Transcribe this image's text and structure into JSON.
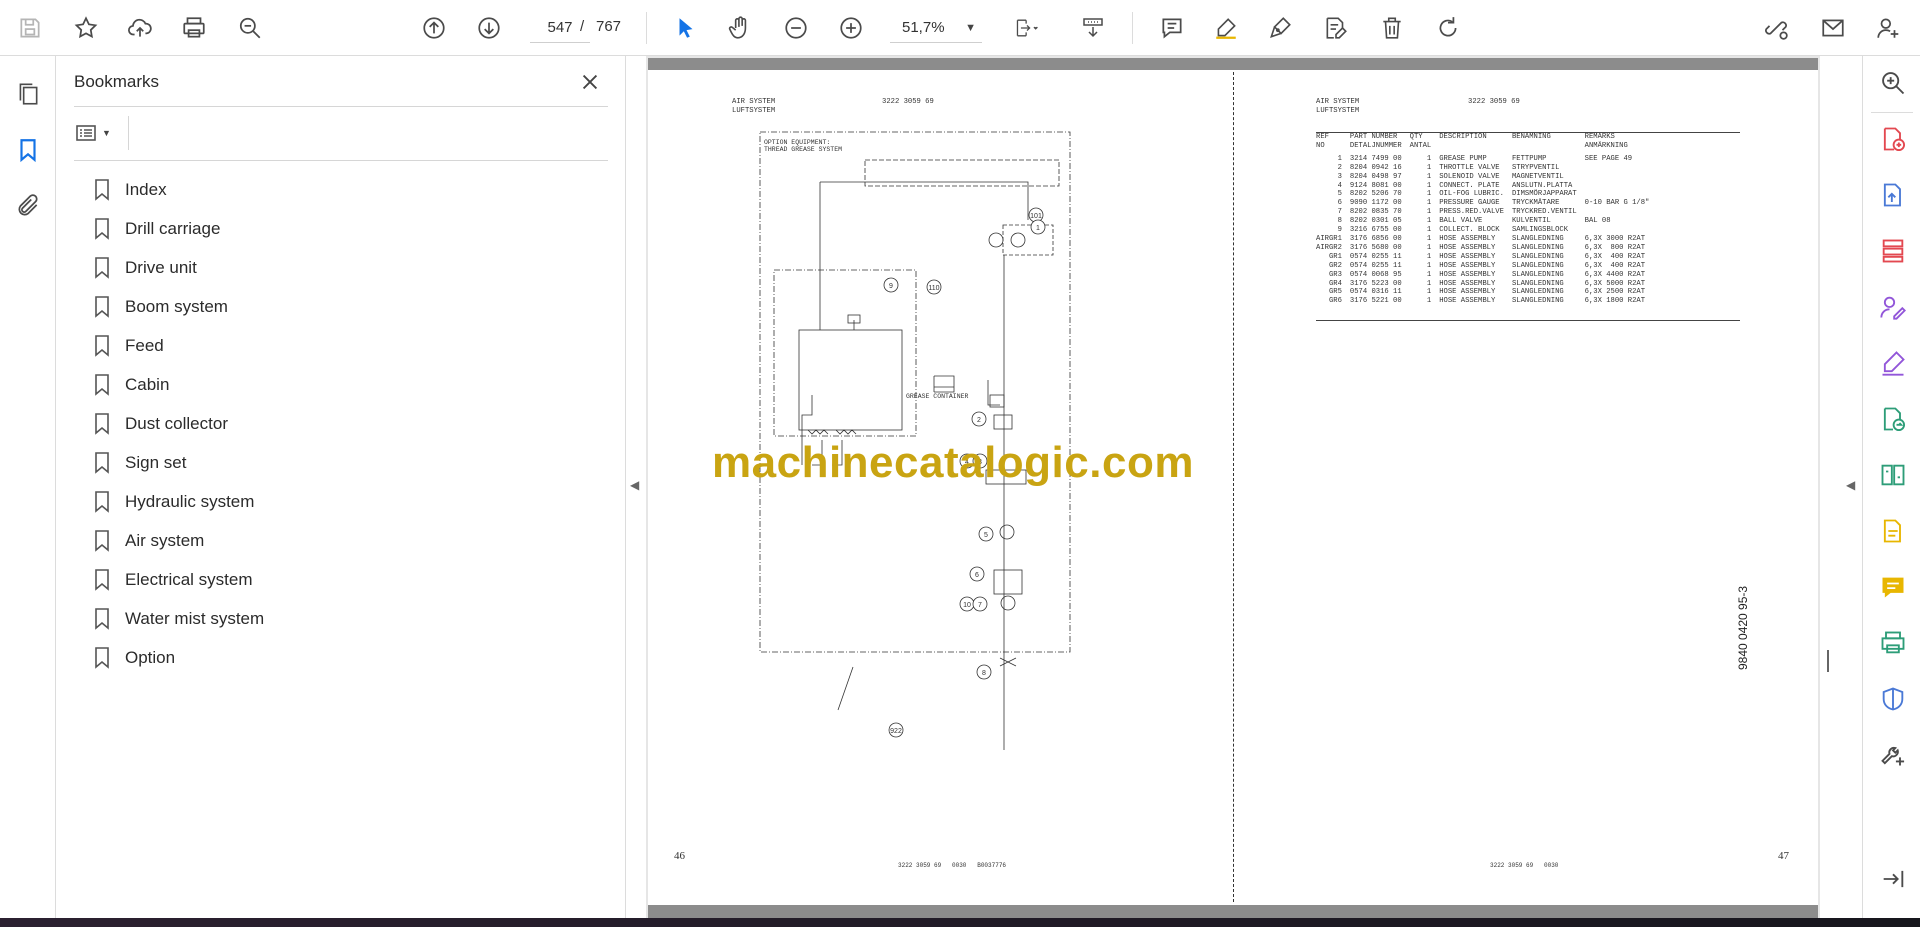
{
  "toolbar": {
    "page_current": "547",
    "page_separator": "/",
    "page_total": "767",
    "zoom": "51,7%"
  },
  "panel": {
    "title": "Bookmarks",
    "bookmarks": [
      "Index",
      "Drill carriage",
      "Drive unit",
      "Boom system",
      "Feed",
      "Cabin",
      "Dust collector",
      "Sign set",
      "Hydraulic system",
      "Air system",
      "Electrical system",
      "Water mist system",
      "Option"
    ]
  },
  "doc": {
    "left_header_1": "AIR SYSTEM",
    "left_header_2": "LUFTSYSTEM",
    "left_header_code": "3222 3059 69",
    "right_header_1": "AIR SYSTEM",
    "right_header_2": "LUFTSYSTEM",
    "right_header_code": "3222 3059 69",
    "left_page_number": "46",
    "right_page_number": "47",
    "left_footer": "3222 3059 69   0030   B0037776",
    "right_footer": "3222 3059 69   0030",
    "drawing_number": "9840 0420 95-3",
    "option_label_1": "OPTION EQUIPMENT:",
    "option_label_2": "THREAD GREASE SYSTEM",
    "grease_container": "GREASE CONTAINER",
    "watermark": "machinecatalogic.com",
    "table_headers": [
      [
        "REF",
        "NO"
      ],
      [
        "PART NUMBER",
        "DETALJNUMMER"
      ],
      [
        "QTY",
        "ANTAL"
      ],
      [
        "DESCRIPTION",
        ""
      ],
      [
        "BENÄMNING",
        ""
      ],
      [
        "REMARKS",
        "ANMÄRKNING"
      ]
    ],
    "parts": [
      [
        "1",
        "3214 7499 00",
        "1",
        "GREASE PUMP",
        "FETTPUMP",
        "SEE PAGE 49"
      ],
      [
        "2",
        "8204 0942 16",
        "1",
        "THROTTLE VALVE",
        "STRYPVENTIL",
        ""
      ],
      [
        "3",
        "8204 0498 97",
        "1",
        "SOLENOID VALVE",
        "MAGNETVENTIL",
        ""
      ],
      [
        "4",
        "9124 8081 00",
        "1",
        "CONNECT. PLATE",
        "ANSLUTN.PLATTA",
        ""
      ],
      [
        "5",
        "8202 5206 70",
        "1",
        "OIL-FOG LUBRIC.",
        "DIMSMÖRJAPPARAT",
        ""
      ],
      [
        "6",
        "9090 1172 00",
        "1",
        "PRESSURE GAUGE",
        "TRYCKMÄTARE",
        "0-10 BAR G 1/8\""
      ],
      [
        "7",
        "8202 0835 70",
        "1",
        "PRESS.RED.VALVE",
        "TRYCKRED.VENTIL",
        ""
      ],
      [
        "8",
        "8202 0301 05",
        "1",
        "BALL VALVE",
        "KULVENTIL",
        "BAL 08"
      ],
      [
        "9",
        "3216 6755 00",
        "1",
        "COLLECT. BLOCK",
        "SAMLINGSBLOCK",
        ""
      ],
      [
        "AIRGR1",
        "3176 6856 00",
        "1",
        "HOSE ASSEMBLY",
        "SLANGLEDNING",
        "6,3X 3000 R2AT"
      ],
      [
        "AIRGR2",
        "3176 5680 00",
        "1",
        "HOSE ASSEMBLY",
        "SLANGLEDNING",
        "6,3X  800 R2AT"
      ],
      [
        "GR1",
        "0574 0255 11",
        "1",
        "HOSE ASSEMBLY",
        "SLANGLEDNING",
        "6,3X  400 R2AT"
      ],
      [
        "GR2",
        "0574 0255 11",
        "1",
        "HOSE ASSEMBLY",
        "SLANGLEDNING",
        "6,3X  400 R2AT"
      ],
      [
        "GR3",
        "0574 0068 95",
        "1",
        "HOSE ASSEMBLY",
        "SLANGLEDNING",
        "6,3X 4400 R2AT"
      ],
      [
        "GR4",
        "3176 5223 00",
        "1",
        "HOSE ASSEMBLY",
        "SLANGLEDNING",
        "6,3X 5000 R2AT"
      ],
      [
        "GR5",
        "0574 0316 11",
        "1",
        "HOSE ASSEMBLY",
        "SLANGLEDNING",
        "6,3X 2500 R2AT"
      ],
      [
        "GR6",
        "3176 5221 00",
        "1",
        "HOSE ASSEMBLY",
        "SLANGLEDNING",
        "6,3X 1800 R2AT"
      ]
    ],
    "callouts": [
      "101",
      "1",
      "110",
      "9",
      "2",
      "4",
      "3",
      "5",
      "6",
      "10",
      "7",
      "8",
      "922"
    ]
  },
  "colors": {
    "accent_blue": "#1473e6",
    "icon_gray": "#4b4b4b",
    "watermark": "#c9a412",
    "rail_red": "#e34850",
    "rail_purple": "#9256d9",
    "rail_green": "#2d9d78",
    "rail_yellow": "#e8b600"
  }
}
